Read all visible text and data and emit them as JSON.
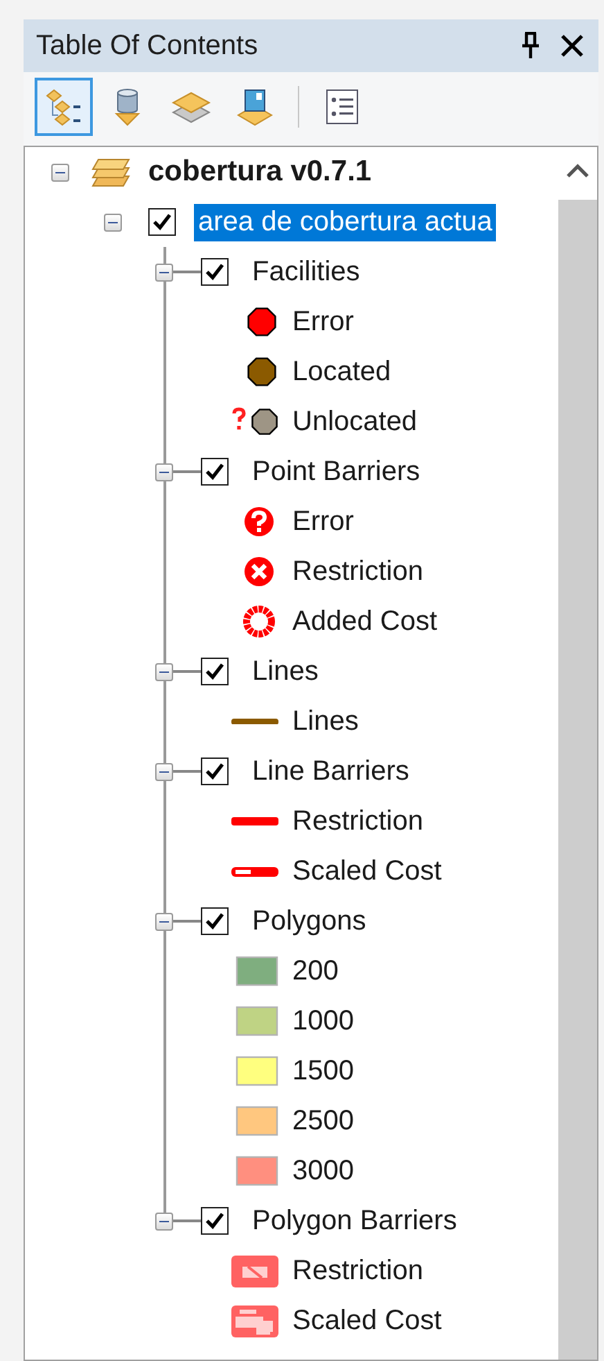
{
  "panel": {
    "title": "Table Of Contents"
  },
  "toolbar": {
    "buttons": [
      {
        "kind": "drawing-order",
        "selected": true
      },
      {
        "kind": "source",
        "selected": false
      },
      {
        "kind": "visibility",
        "selected": false
      },
      {
        "kind": "selection",
        "selected": false
      },
      {
        "kind": "options",
        "selected": false
      }
    ]
  },
  "tree": {
    "label": "cobertura v0.7.1",
    "expanded": true,
    "children": [
      {
        "label": "area de cobertura actua",
        "checked": true,
        "selected": true,
        "expanded": true,
        "children": [
          {
            "label": "Facilities",
            "checked": true,
            "expanded": true,
            "legend": [
              {
                "label": "Error",
                "kind": "point",
                "color": "#ff0000"
              },
              {
                "label": "Located",
                "kind": "point",
                "color": "#8b5a00"
              },
              {
                "label": "Unlocated",
                "kind": "unlocated-point",
                "color": "#9e9585"
              }
            ]
          },
          {
            "label": "Point Barriers",
            "checked": true,
            "expanded": true,
            "legend": [
              {
                "label": "Error",
                "kind": "question-marker"
              },
              {
                "label": "Restriction",
                "kind": "cross-marker"
              },
              {
                "label": "Added Cost",
                "kind": "ring-marker"
              }
            ]
          },
          {
            "label": "Lines",
            "checked": true,
            "expanded": true,
            "legend": [
              {
                "label": "Lines",
                "kind": "line",
                "color": "#8b5a00"
              }
            ]
          },
          {
            "label": "Line Barriers",
            "checked": true,
            "expanded": true,
            "legend": [
              {
                "label": "Restriction",
                "kind": "line",
                "color": "#ff0000"
              },
              {
                "label": "Scaled Cost",
                "kind": "hollow-line",
                "color": "#ff0000"
              }
            ]
          },
          {
            "label": "Polygons",
            "checked": true,
            "expanded": true,
            "legend": [
              {
                "label": "200",
                "kind": "fill",
                "color": "#7fae7f"
              },
              {
                "label": "1000",
                "kind": "fill",
                "color": "#bfd384"
              },
              {
                "label": "1500",
                "kind": "fill",
                "color": "#ffff7f"
              },
              {
                "label": "2500",
                "kind": "fill",
                "color": "#ffc77f"
              },
              {
                "label": "3000",
                "kind": "fill",
                "color": "#ff8f7f"
              }
            ]
          },
          {
            "label": "Polygon Barriers",
            "checked": true,
            "expanded": true,
            "legend": [
              {
                "label": "Restriction",
                "kind": "hatch-block"
              },
              {
                "label": "Scaled Cost",
                "kind": "split-block"
              }
            ]
          }
        ]
      }
    ]
  }
}
